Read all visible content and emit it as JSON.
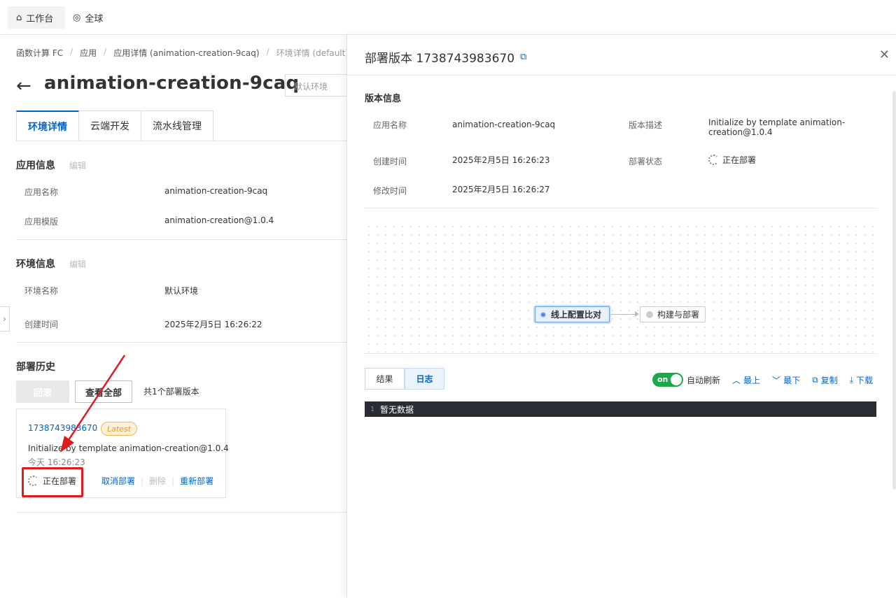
{
  "topbar": {
    "workspace": "工作台",
    "region": "全球"
  },
  "breadcrumb": [
    "函数计算 FC",
    "应用",
    "应用详情 (animation-creation-9caq)",
    "环境详情 (default)"
  ],
  "page": {
    "title": "animation-creation-9caq",
    "env_select": "默认环境"
  },
  "tabs": [
    "环境详情",
    "云端开发",
    "流水线管理"
  ],
  "app_info": {
    "title": "应用信息",
    "edit": "编辑",
    "rows": [
      {
        "k": "应用名称",
        "v": "animation-creation-9caq"
      },
      {
        "k": "应用模版",
        "v": "animation-creation@1.0.4"
      }
    ]
  },
  "env_info": {
    "title": "环境信息",
    "edit": "编辑",
    "rows": [
      {
        "k": "环境名称",
        "v": "默认环境"
      },
      {
        "k": "创建时间",
        "v": "2025年2月5日 16:26:22"
      }
    ]
  },
  "history": {
    "title": "部署历史",
    "rollback": "回滚",
    "view_all": "查看全部",
    "count": "共1个部署版本",
    "card": {
      "version": "1738743983670",
      "badge": "Latest",
      "desc": "Initialize by template animation-creation@1.0.4",
      "time": "今天 16:26:23",
      "status": "正在部署",
      "cancel": "取消部署",
      "delete": "删除",
      "redeploy": "重新部署"
    }
  },
  "panel": {
    "title": "部署版本 1738743983670",
    "section": "版本信息",
    "fields": {
      "app_name_k": "应用名称",
      "app_name_v": "animation-creation-9caq",
      "desc_k": "版本描述",
      "desc_v": "Initialize by template animation-creation@1.0.4",
      "created_k": "创建时间",
      "created_v": "2025年2月5日 16:26:23",
      "status_k": "部署状态",
      "status_v": "正在部署",
      "modified_k": "修改时间",
      "modified_v": "2025年2月5日 16:26:27"
    },
    "flow": {
      "node1": "线上配置比对",
      "node2": "构建与部署"
    },
    "tabs": {
      "result": "结果",
      "log": "日志"
    },
    "toolbar": {
      "switch": "on",
      "auto_refresh": "自动刷新",
      "top": "最上",
      "bottom": "最下",
      "copy": "复制",
      "download": "下载"
    },
    "log": {
      "line_no": "1",
      "text": "暂无数据"
    }
  },
  "colors": {
    "primary": "#0064c8",
    "success": "#1aa84a",
    "highlight": "#e01b1b"
  }
}
